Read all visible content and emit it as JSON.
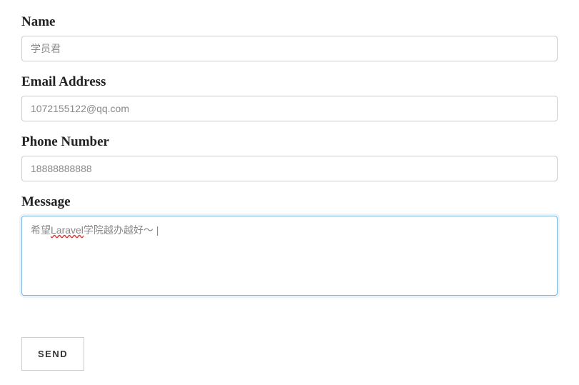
{
  "form": {
    "name": {
      "label": "Name",
      "value": "学员君"
    },
    "email": {
      "label": "Email Address",
      "value": "1072155122@qq.com"
    },
    "phone": {
      "label": "Phone Number",
      "value": "18888888888"
    },
    "message": {
      "label": "Message",
      "value_prefix": "希望",
      "value_underlined": "Laravel",
      "value_suffix": "学院越办越好～"
    },
    "submit": {
      "label": "SEND"
    }
  }
}
